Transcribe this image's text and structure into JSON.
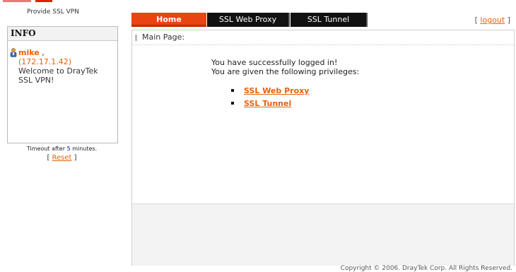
{
  "header": {
    "tagline": "Provide SSL VPN"
  },
  "info": {
    "title": "INFO",
    "username": "mike",
    "separator": " ,",
    "ip": "(172.17.1.42)",
    "welcome": "Welcome to DrayTek SSL VPN!"
  },
  "timeout": {
    "prefix": "Timeout after ",
    "minutes": "5",
    "suffix": " minutes.",
    "reset_open": "[ ",
    "reset_label": "Reset",
    "reset_close": " ]"
  },
  "tabs": [
    {
      "label": "Home",
      "active": true
    },
    {
      "label": "SSL Web Proxy",
      "active": false
    },
    {
      "label": "SSL Tunnel",
      "active": false
    }
  ],
  "logout": {
    "open": "[ ",
    "label": "logout",
    "close": " ]"
  },
  "main": {
    "page_title": "Main Page:",
    "message_1": "You have successfully logged in!",
    "message_2": "You are given the following privileges:",
    "privileges": [
      "SSL Web Proxy",
      "SSL Tunnel"
    ]
  },
  "footer": {
    "copyright": "Copyright © 2006. DrayTek Corp. All Rights Reserved."
  },
  "colors": {
    "accent": "#e8600c",
    "tab_active": "#e84513",
    "tab_inactive": "#111111"
  }
}
